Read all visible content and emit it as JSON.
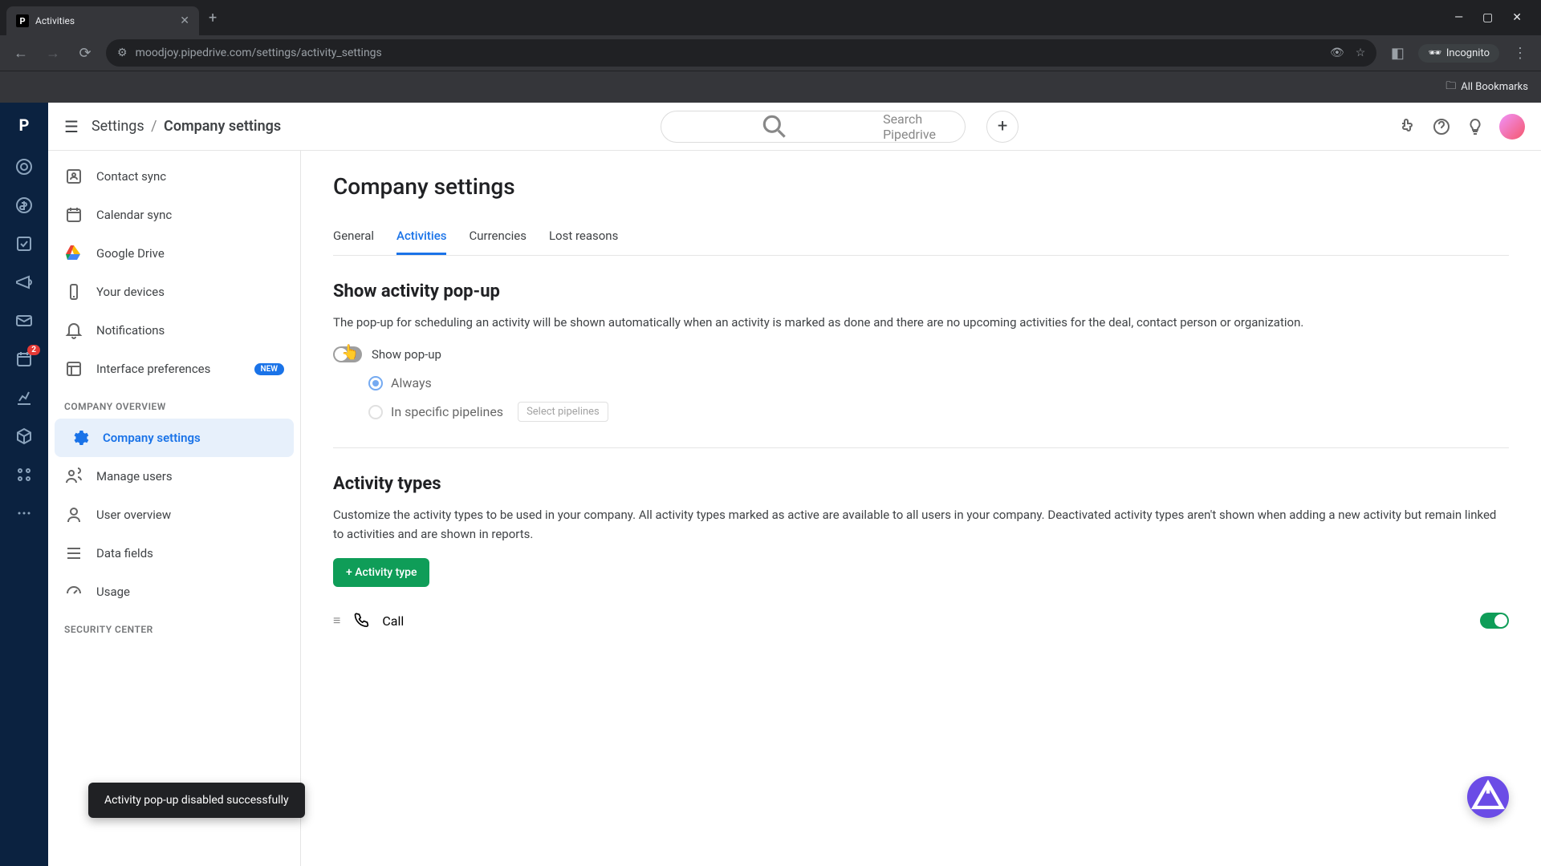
{
  "browser": {
    "tab_title": "Activities",
    "url": "moodjoy.pipedrive.com/settings/activity_settings",
    "incognito": "Incognito",
    "all_bookmarks": "All Bookmarks"
  },
  "header": {
    "breadcrumb_root": "Settings",
    "breadcrumb_current": "Company settings",
    "search_placeholder": "Search Pipedrive"
  },
  "sidebar": {
    "items": [
      {
        "label": "Contact sync"
      },
      {
        "label": "Calendar sync"
      },
      {
        "label": "Google Drive"
      },
      {
        "label": "Your devices"
      },
      {
        "label": "Notifications"
      },
      {
        "label": "Interface preferences",
        "badge": "NEW"
      }
    ],
    "section1": "COMPANY OVERVIEW",
    "company_items": [
      {
        "label": "Company settings"
      },
      {
        "label": "Manage users"
      },
      {
        "label": "User overview"
      },
      {
        "label": "Data fields"
      },
      {
        "label": "Usage"
      }
    ],
    "section2": "SECURITY CENTER"
  },
  "rail": {
    "badge_count": "2"
  },
  "page": {
    "title": "Company settings",
    "tabs": [
      "General",
      "Activities",
      "Currencies",
      "Lost reasons"
    ],
    "section1": {
      "title": "Show activity pop-up",
      "desc": "The pop-up for scheduling an activity will be shown automatically when an activity is marked as done and there are no upcoming activities for the deal, contact person or organization.",
      "toggle_label": "Show pop-up",
      "radio1": "Always",
      "radio2": "In specific pipelines",
      "select_pipelines": "Select pipelines"
    },
    "section2": {
      "title": "Activity types",
      "desc": "Customize the activity types to be used in your company. All activity types marked as active are available to all users in your company. Deactivated activity types aren't shown when adding a new activity but remain linked to activities and are shown in reports.",
      "add_btn": "+ Activity type",
      "row1": "Call"
    }
  },
  "toast": "Activity pop-up disabled successfully"
}
